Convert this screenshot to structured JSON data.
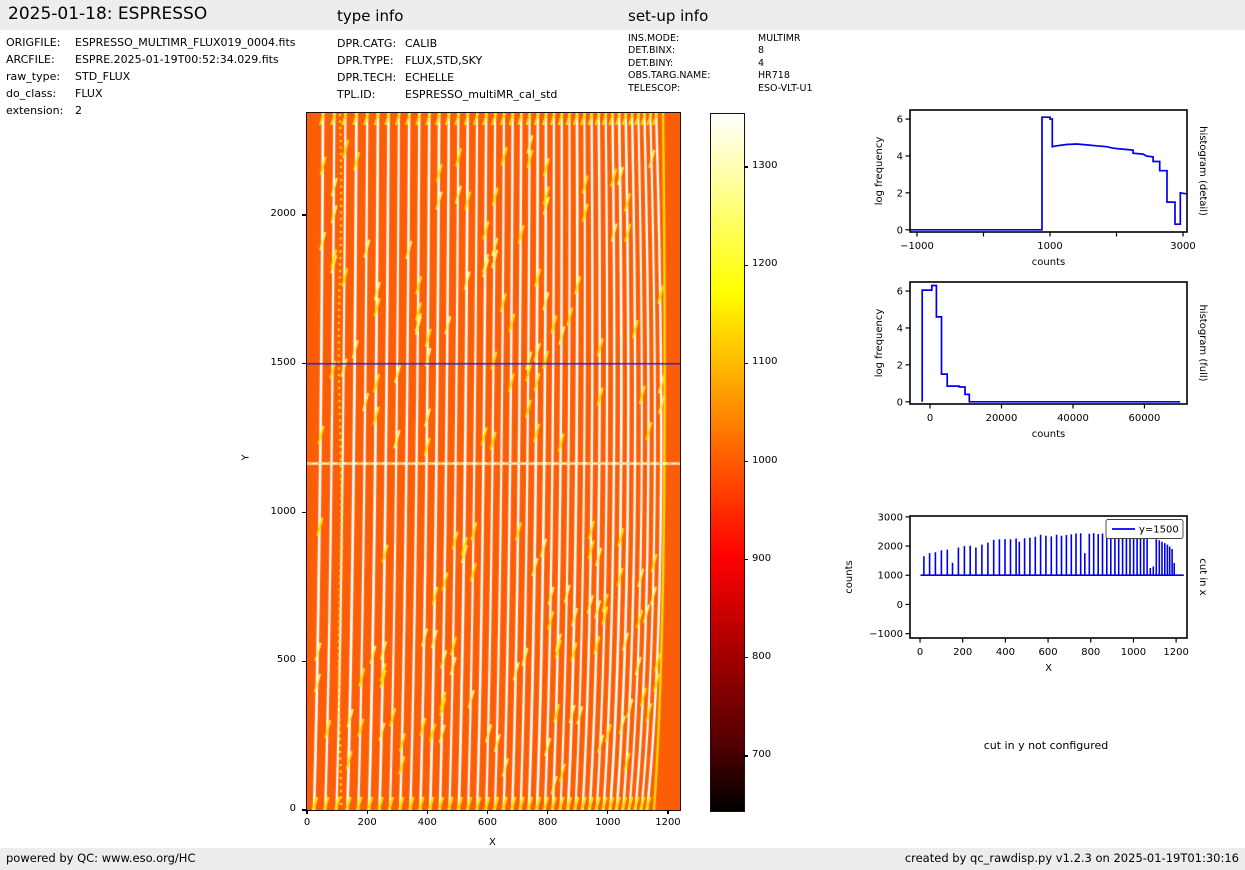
{
  "header": {
    "title": "2025-01-18: ESPRESSO",
    "type_info_title": "type info",
    "setup_info_title": "set-up info"
  },
  "file_info": {
    "rows": [
      {
        "label": "ORIGFILE:",
        "value": "ESPRESSO_MULTIMR_FLUX019_0004.fits"
      },
      {
        "label": "ARCFILE:",
        "value": "ESPRE.2025-01-19T00:52:34.029.fits"
      },
      {
        "label": "raw_type:",
        "value": "STD_FLUX"
      },
      {
        "label": "do_class:",
        "value": "FLUX"
      },
      {
        "label": "extension:",
        "value": "2"
      }
    ]
  },
  "type_info": {
    "rows": [
      {
        "label": "DPR.CATG:",
        "value": "CALIB"
      },
      {
        "label": "DPR.TYPE:",
        "value": "FLUX,STD,SKY"
      },
      {
        "label": "DPR.TECH:",
        "value": "ECHELLE"
      },
      {
        "label": "TPL.ID:",
        "value": "ESPRESSO_multiMR_cal_std"
      }
    ]
  },
  "setup_info": {
    "rows": [
      {
        "label": "INS.MODE:",
        "value": "MULTIMR"
      },
      {
        "label": "DET.BINX:",
        "value": "8"
      },
      {
        "label": "DET.BINY:",
        "value": "4"
      },
      {
        "label": "OBS.TARG.NAME:",
        "value": "HR718"
      },
      {
        "label": "TELESCOP:",
        "value": "ESO-VLT-U1"
      }
    ]
  },
  "footer": {
    "left": "powered by QC: www.eso.org/HC",
    "right": "created by qc_rawdisp.py v1.2.3 on 2025-01-19T01:30:16"
  },
  "colors": {
    "accent_blue": "#0000ee",
    "cut_line_blue": "#2323cf",
    "image_orange": "#fb5e06",
    "stripe_white": "#ffffff",
    "streak_yellow": "#ffe000",
    "bar_gray": "#ededed"
  },
  "chart_data": [
    {
      "id": "raw_image",
      "type": "heatmap",
      "xlabel": "X",
      "ylabel": "Y",
      "xlim": [
        0,
        1240
      ],
      "ylim": [
        0,
        2343
      ],
      "xticks": [
        0,
        200,
        400,
        600,
        800,
        1000,
        1200
      ],
      "yticks": [
        0,
        500,
        1000,
        1500,
        2000
      ],
      "description": "ESPRESSO raw echelle flat frame: orange background (~1000 counts) with ~40 near-vertical bright spectral orders, converging toward the right edge",
      "n_stripes": 40,
      "cut_line_y": 1500,
      "bright_row_y": 1165,
      "dotted_column_x": 110,
      "colorbar": {
        "colormap": "hot",
        "vmin": 645,
        "vmax": 1355,
        "ticks": [
          1300,
          1200,
          1100,
          1000,
          900,
          800,
          700
        ]
      }
    },
    {
      "id": "histogram_detail",
      "type": "line",
      "right_label": "histogram (detail)",
      "xlabel": "counts",
      "ylabel": "log frequency",
      "xlim": [
        -1105,
        3060
      ],
      "ylim": [
        -0.12,
        6.49
      ],
      "xticks": [
        {
          "v": -1000,
          "label": "−1000"
        },
        {
          "v": 0,
          "label": ""
        },
        {
          "v": 1000,
          "label": "1000"
        },
        {
          "v": 2000,
          "label": ""
        },
        {
          "v": 3000,
          "label": "3000"
        }
      ],
      "yticks": [
        {
          "v": 0,
          "label": "0"
        },
        {
          "v": 2,
          "label": "2"
        },
        {
          "v": 4,
          "label": "4"
        },
        {
          "v": 6,
          "label": "6"
        }
      ],
      "steps": [
        [
          -1100,
          0
        ],
        [
          880,
          0
        ],
        [
          880,
          6.1
        ],
        [
          1000,
          6.1
        ],
        [
          1000,
          6.0
        ],
        [
          1035,
          6.0
        ],
        [
          1035,
          4.5
        ],
        [
          1100,
          4.55
        ],
        [
          1250,
          4.62
        ],
        [
          1400,
          4.65
        ],
        [
          1550,
          4.6
        ],
        [
          1700,
          4.55
        ],
        [
          1850,
          4.5
        ],
        [
          1950,
          4.42
        ],
        [
          2050,
          4.38
        ],
        [
          2150,
          4.35
        ],
        [
          2250,
          4.32
        ],
        [
          2250,
          4.15
        ],
        [
          2400,
          4.1
        ],
        [
          2450,
          4.0
        ],
        [
          2550,
          3.95
        ],
        [
          2550,
          3.7
        ],
        [
          2650,
          3.7
        ],
        [
          2650,
          3.2
        ],
        [
          2760,
          3.2
        ],
        [
          2760,
          1.5
        ],
        [
          2880,
          1.5
        ],
        [
          2880,
          0.3
        ],
        [
          2960,
          0.3
        ],
        [
          2960,
          2.0
        ],
        [
          3050,
          1.95
        ]
      ]
    },
    {
      "id": "histogram_full",
      "type": "line",
      "right_label": "histogram (full)",
      "xlabel": "counts",
      "ylabel": "log frequency",
      "xlim": [
        -5600,
        71900
      ],
      "ylim": [
        -0.12,
        6.49
      ],
      "xticks": [
        {
          "v": 0,
          "label": "0"
        },
        {
          "v": 20000,
          "label": "20000"
        },
        {
          "v": 40000,
          "label": "40000"
        },
        {
          "v": 60000,
          "label": "60000"
        }
      ],
      "yticks": [
        {
          "v": 0,
          "label": "0"
        },
        {
          "v": 2,
          "label": "2"
        },
        {
          "v": 4,
          "label": "4"
        },
        {
          "v": 6,
          "label": "6"
        }
      ],
      "steps": [
        [
          -2200,
          0
        ],
        [
          -2200,
          6.05
        ],
        [
          500,
          6.05
        ],
        [
          500,
          6.3
        ],
        [
          1800,
          6.3
        ],
        [
          1800,
          4.6
        ],
        [
          3200,
          4.6
        ],
        [
          3200,
          1.5
        ],
        [
          4800,
          1.5
        ],
        [
          4800,
          0.85
        ],
        [
          8200,
          0.85
        ],
        [
          8200,
          0.8
        ],
        [
          9800,
          0.8
        ],
        [
          9800,
          0.4
        ],
        [
          11000,
          0.4
        ],
        [
          11000,
          0
        ],
        [
          70000,
          0
        ]
      ]
    },
    {
      "id": "cut_in_x",
      "type": "line",
      "right_label": "cut in x",
      "xlabel": "X",
      "ylabel": "counts",
      "legend_label": "y=1500",
      "xlim": [
        -47,
        1251
      ],
      "ylim": [
        -1150,
        3030
      ],
      "xticks": [
        {
          "v": 0,
          "label": "0"
        },
        {
          "v": 200,
          "label": "200"
        },
        {
          "v": 400,
          "label": "400"
        },
        {
          "v": 600,
          "label": "600"
        },
        {
          "v": 800,
          "label": "800"
        },
        {
          "v": 1000,
          "label": "1000"
        },
        {
          "v": 1200,
          "label": "1200"
        }
      ],
      "yticks": [
        {
          "v": -1000,
          "label": "−1000"
        },
        {
          "v": 0,
          "label": "0"
        },
        {
          "v": 1000,
          "label": "1000"
        },
        {
          "v": 2000,
          "label": "2000"
        },
        {
          "v": 3000,
          "label": "3000"
        }
      ],
      "baseline": 1000,
      "spikes": [
        [
          18,
          1650
        ],
        [
          45,
          1760
        ],
        [
          72,
          1790
        ],
        [
          100,
          1850
        ],
        [
          128,
          1880
        ],
        [
          152,
          1430
        ],
        [
          180,
          1950
        ],
        [
          208,
          2000
        ],
        [
          235,
          2010
        ],
        [
          262,
          1950
        ],
        [
          290,
          2050
        ],
        [
          318,
          2120
        ],
        [
          345,
          2210
        ],
        [
          372,
          2230
        ],
        [
          398,
          2240
        ],
        [
          424,
          2230
        ],
        [
          450,
          2260
        ],
        [
          465,
          2150
        ],
        [
          490,
          2270
        ],
        [
          515,
          2290
        ],
        [
          540,
          2320
        ],
        [
          565,
          2390
        ],
        [
          590,
          2350
        ],
        [
          615,
          2330
        ],
        [
          640,
          2390
        ],
        [
          663,
          2350
        ],
        [
          686,
          2380
        ],
        [
          709,
          2400
        ],
        [
          731,
          2430
        ],
        [
          753,
          2440
        ],
        [
          772,
          1760
        ],
        [
          793,
          2420
        ],
        [
          814,
          2440
        ],
        [
          835,
          2410
        ],
        [
          855,
          2430
        ],
        [
          875,
          2450
        ],
        [
          894,
          2400
        ],
        [
          913,
          2380
        ],
        [
          931,
          2350
        ],
        [
          949,
          2360
        ],
        [
          967,
          2350
        ],
        [
          984,
          2340
        ],
        [
          1001,
          2330
        ],
        [
          1017,
          2300
        ],
        [
          1033,
          2280
        ],
        [
          1049,
          2260
        ],
        [
          1064,
          2240
        ],
        [
          1079,
          1250
        ],
        [
          1093,
          1300
        ],
        [
          1107,
          2230
        ],
        [
          1121,
          2200
        ],
        [
          1134,
          2150
        ],
        [
          1147,
          2100
        ],
        [
          1159,
          2050
        ],
        [
          1170,
          1980
        ],
        [
          1181,
          1900
        ],
        [
          1191,
          1420
        ]
      ]
    },
    {
      "id": "cut_in_y",
      "type": "message",
      "text": "cut in y not configured"
    }
  ]
}
